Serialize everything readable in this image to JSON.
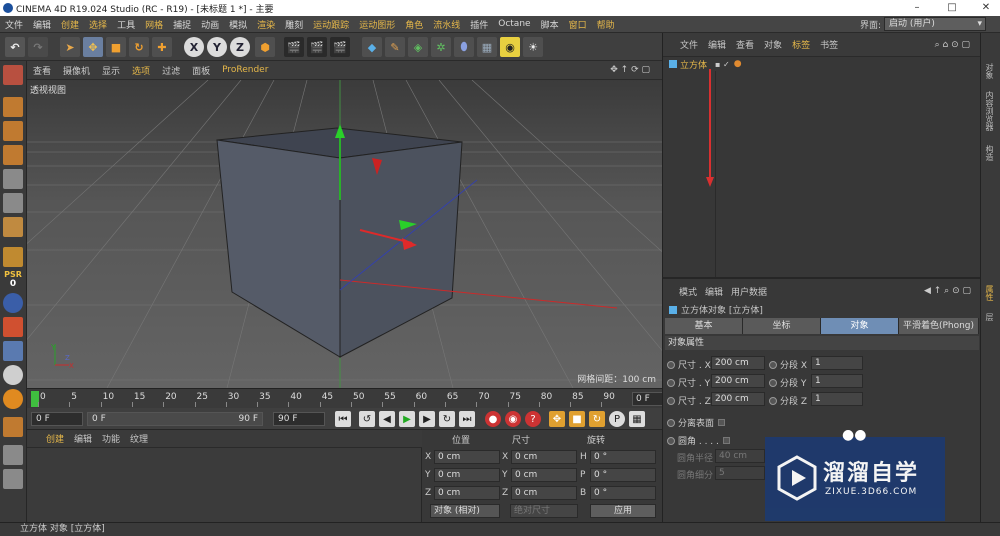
{
  "window": {
    "title": "CINEMA 4D R19.024 Studio (RC - R19) - [未标题 1 *] - 主要",
    "min": "–",
    "max": "□",
    "close": "✕"
  },
  "menubar": [
    "文件",
    "编辑",
    "创建",
    "选择",
    "工具",
    "网格",
    "捕捉",
    "动画",
    "模拟",
    "渲染",
    "雕刻",
    "运动跟踪",
    "运动图形",
    "角色",
    "流水线",
    "插件",
    "Octane",
    "脚本",
    "窗口",
    "帮助"
  ],
  "layout": {
    "label": "界面:",
    "value": "启动 (用户)"
  },
  "toolbar": {
    "x": "X",
    "y": "Y",
    "z": "Z"
  },
  "lefttools": {
    "psr": "PSR",
    "psr_val": "0"
  },
  "viewport": {
    "menu": [
      "查看",
      "摄像机",
      "显示",
      "选项",
      "过滤",
      "面板",
      "ProRender"
    ],
    "label": "透视视图",
    "grid_label": "网格间距：100 cm"
  },
  "timeline": {
    "ticks": [
      "0",
      "5",
      "10",
      "15",
      "20",
      "25",
      "30",
      "35",
      "40",
      "45",
      "50",
      "55",
      "60",
      "65",
      "70",
      "75",
      "80",
      "85",
      "90"
    ],
    "frame": "0 F"
  },
  "transport": {
    "start": "0 F",
    "range_start": "0 F",
    "range_end": "90 F",
    "end": "90 F"
  },
  "material": {
    "menu": [
      "创建",
      "编辑",
      "功能",
      "纹理"
    ]
  },
  "coords": {
    "headers": [
      "位置",
      "尺寸",
      "旋转"
    ],
    "rows": [
      {
        "axis": "X",
        "pos": "0 cm",
        "size_axis": "X",
        "size": "0 cm",
        "rot_axis": "H",
        "rot": "0 °"
      },
      {
        "axis": "Y",
        "pos": "0 cm",
        "size_axis": "Y",
        "size": "0 cm",
        "rot_axis": "P",
        "rot": "0 °"
      },
      {
        "axis": "Z",
        "pos": "0 cm",
        "size_axis": "Z",
        "size": "0 cm",
        "rot_axis": "B",
        "rot": "0 °"
      }
    ],
    "mode": "对象 (相对)",
    "size_mode": "绝对尺寸",
    "apply": "应用"
  },
  "objects": {
    "menu": [
      "文件",
      "编辑",
      "查看",
      "对象",
      "标签",
      "书签"
    ],
    "items": [
      {
        "name": "立方体"
      }
    ]
  },
  "rightstrip": [
    "对象",
    "内容浏览器",
    "构造",
    "属性",
    "层"
  ],
  "attributes": {
    "menu": [
      "模式",
      "编辑",
      "用户数据"
    ],
    "title": "立方体对象 [立方体]",
    "tabs": [
      "基本",
      "坐标",
      "对象",
      "平滑着色(Phong)"
    ],
    "section": "对象属性",
    "rows": [
      {
        "label": "尺寸 . X",
        "value": "200 cm",
        "seg_label": "分段 X",
        "seg": "1"
      },
      {
        "label": "尺寸 . Y",
        "value": "200 cm",
        "seg_label": "分段 Y",
        "seg": "1"
      },
      {
        "label": "尺寸 . Z",
        "value": "200 cm",
        "seg_label": "分段 Z",
        "seg": "1"
      }
    ],
    "separate": "分离表面",
    "fillet": "圆角 . . . .",
    "fillet_radius_label": "圆角半径",
    "fillet_radius": "40 cm",
    "fillet_sub_label": "圆角细分",
    "fillet_sub": "5"
  },
  "status": "立方体 对象 [立方体]",
  "watermark": {
    "cn": "溜溜自学",
    "url": "ZIXUE.3D66.COM"
  }
}
